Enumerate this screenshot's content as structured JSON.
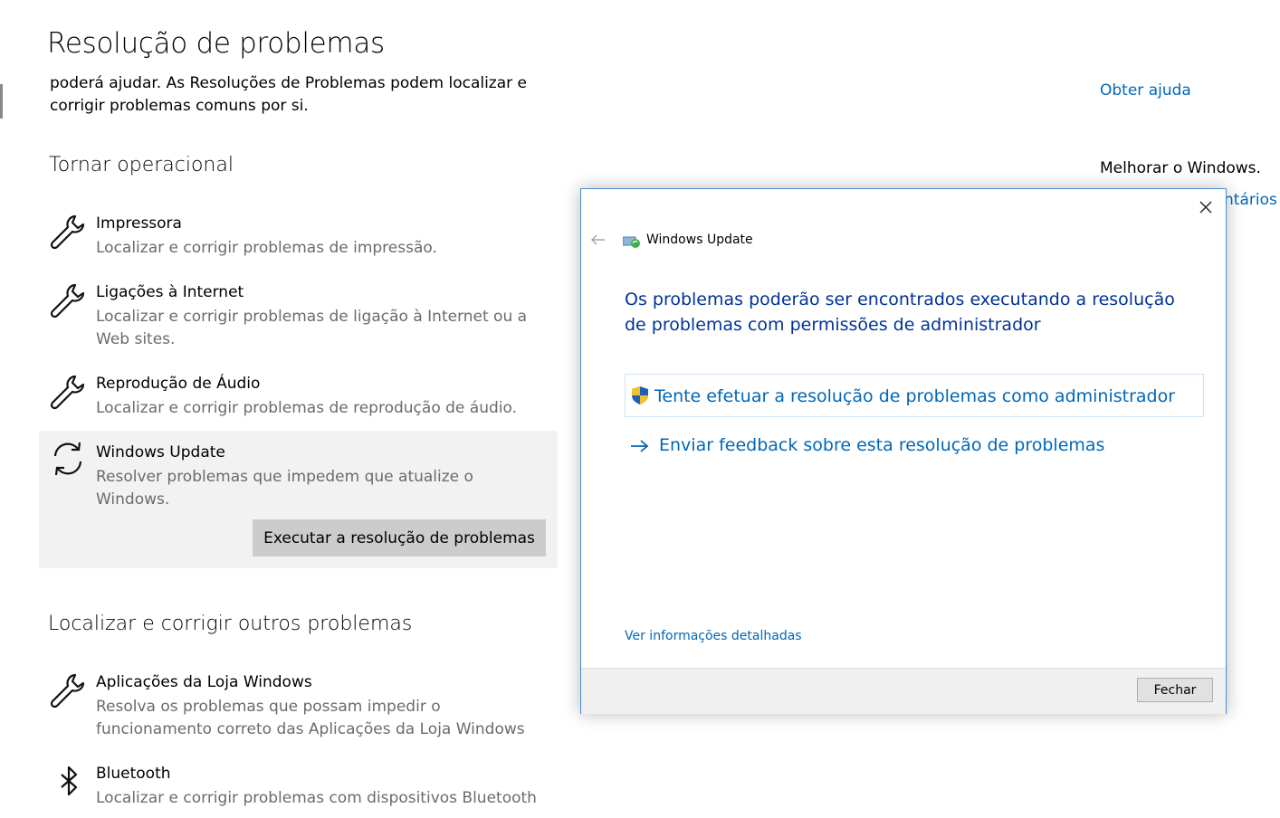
{
  "page": {
    "title": "Resolução de problemas",
    "intro": "poderá ajudar. As Resoluções de Problemas podem localizar e corrigir problemas comuns por si."
  },
  "sections": {
    "get_running": {
      "title": "Tornar operacional",
      "items": [
        {
          "name": "Impressora",
          "desc": "Localizar e corrigir problemas de impressão.",
          "icon": "wrench-icon"
        },
        {
          "name": "Ligações à Internet",
          "desc": "Localizar e corrigir problemas de ligação à Internet ou a Web sites.",
          "icon": "wrench-icon"
        },
        {
          "name": "Reprodução de Áudio",
          "desc": "Localizar e corrigir problemas de reprodução de áudio.",
          "icon": "wrench-icon"
        },
        {
          "name": "Windows Update",
          "desc": "Resolver problemas que impedem que atualize o Windows.",
          "icon": "sync-icon",
          "selected": true
        }
      ],
      "run_button": "Executar a resolução de problemas"
    },
    "other": {
      "title": "Localizar e corrigir outros problemas",
      "items": [
        {
          "name": "Aplicações da Loja Windows",
          "desc": "Resolva os problemas que possam impedir o funcionamento correto das Aplicações da Loja Windows",
          "icon": "wrench-icon"
        },
        {
          "name": "Bluetooth",
          "desc": "Localizar e corrigir problemas com dispositivos Bluetooth",
          "icon": "bluetooth-icon"
        }
      ]
    }
  },
  "right_panel": {
    "help_link": "Obter ajuda",
    "improve_text": "Melhorar o Windows.",
    "feedback_link_partial": "ntários"
  },
  "dialog": {
    "title": "Windows Update",
    "heading": "Os problemas poderão ser encontrados executando a resolução de problemas com permissões de administrador",
    "admin_option": "Tente efetuar a resolução de problemas como administrador",
    "feedback_option": "Enviar feedback sobre esta resolução de problemas",
    "details_link": "Ver informações detalhadas",
    "close_button": "Fechar"
  },
  "colors": {
    "accent": "#0067b8",
    "dialog_heading": "#003399",
    "selected_bg": "#f2f2f2",
    "run_button_bg": "#cccccc"
  }
}
